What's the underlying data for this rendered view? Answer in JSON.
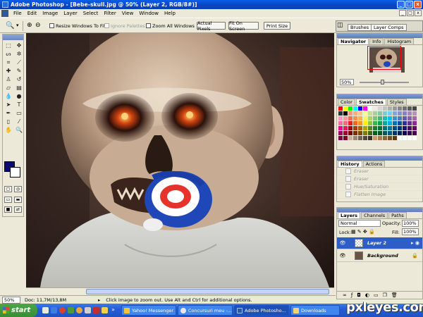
{
  "window": {
    "title": "Adobe Photoshop - [Bebe-skull.jpg @ 50% (Layer 2, RGB/8#)]",
    "minimize": "_",
    "maximize": "□",
    "close": "x"
  },
  "menu": {
    "items": [
      "File",
      "Edit",
      "Image",
      "Layer",
      "Select",
      "Filter",
      "View",
      "Window",
      "Help"
    ],
    "doc_minimize": "_",
    "doc_maximize": "□",
    "doc_close": "x"
  },
  "options_bar": {
    "resize_windows": "Resize Windows To Fit",
    "ignore_palettes": "Ignore Palettes",
    "zoom_all_windows": "Zoom All Windows",
    "actual_pixels": "Actual Pixels",
    "fit_on_screen": "Fit On Screen",
    "print_size": "Print Size",
    "brushes_tab": "Brushes",
    "layer_comps_tab": "Layer Comps"
  },
  "navigator": {
    "tabs": [
      "Navigator",
      "Info",
      "Histogram"
    ],
    "zoom": "50%"
  },
  "swatches": {
    "tabs": [
      "Color",
      "Swatches",
      "Styles"
    ],
    "colors": [
      "#ff0000",
      "#ffff00",
      "#00ff00",
      "#00ffff",
      "#0000ff",
      "#ff00ff",
      "#ffffff",
      "#ebebeb",
      "#d6d6d6",
      "#c2c2c2",
      "#adadad",
      "#999999",
      "#858585",
      "#707070",
      "#5c5c5c",
      "#474747",
      "#333333",
      "#000000",
      "#f7977a",
      "#f9ad81",
      "#fdc68a",
      "#fff79a",
      "#c4df9b",
      "#a2d39c",
      "#82ca9d",
      "#7bcdc8",
      "#6ecff6",
      "#7ea7d8",
      "#8493ca",
      "#8882be",
      "#a187be",
      "#bc8dbf",
      "#f49ac2",
      "#f6989d",
      "#f26c4f",
      "#f68e55",
      "#fbaf5c",
      "#fff467",
      "#acd372",
      "#7cc576",
      "#3bb878",
      "#1abbb4",
      "#00bff3",
      "#438ccb",
      "#5574b9",
      "#605ca8",
      "#855fa8",
      "#a763a8",
      "#f06eaa",
      "#f26d7d",
      "#ed1c24",
      "#f26522",
      "#f7941d",
      "#fff200",
      "#8dc73f",
      "#39b54a",
      "#00a651",
      "#00a99d",
      "#00aeef",
      "#0072bc",
      "#0054a6",
      "#2e3192",
      "#662d91",
      "#92278f",
      "#ec008c",
      "#ed145b",
      "#9e0b0f",
      "#a0410d",
      "#a36209",
      "#aba000",
      "#598527",
      "#1a7b30",
      "#007236",
      "#00746b",
      "#0076a3",
      "#004b80",
      "#003471",
      "#1b1464",
      "#440e62",
      "#630460",
      "#9e005d",
      "#9e0039",
      "#790000",
      "#7b2e00",
      "#7d4900",
      "#827b00",
      "#406618",
      "#005e20",
      "#005826",
      "#005952",
      "#005b7f",
      "#003663",
      "#002157",
      "#0d004c",
      "#32004b",
      "#4b0049",
      "#7b0046",
      "#7a0026",
      "#c7b299",
      "#998675",
      "#736357",
      "#534741",
      "#37302d",
      "#c69c6d",
      "#a67c52",
      "#8c6239",
      "#754c24",
      "#603913",
      "#ffffff",
      "#ffffff",
      "#ffffff",
      "#ffffff"
    ]
  },
  "history": {
    "tabs": [
      "History",
      "Actions"
    ],
    "items": [
      "Eraser",
      "Eraser",
      "Hue/Saturation",
      "Flatten Image"
    ]
  },
  "layers": {
    "tabs": [
      "Layers",
      "Channels",
      "Paths"
    ],
    "blend_mode": "Normal",
    "opacity_label": "Opacity:",
    "opacity_value": "100%",
    "lock_label": "Lock:",
    "fill_label": "Fill:",
    "fill_value": "100%",
    "items": [
      {
        "name": "Layer 2",
        "selected": true
      },
      {
        "name": "Background",
        "selected": false
      }
    ]
  },
  "status_bar": {
    "zoom": "50%",
    "doc": "Doc: 11,7M/13,8M",
    "message": "Click image to zoom out. Use Alt and Ctrl for additional options."
  },
  "taskbar": {
    "start": "start",
    "tasks": [
      {
        "label": "Yahoo! Messenger",
        "color": "#f5c342"
      },
      {
        "label": "Concursuri meu -...",
        "color": "#e8e8e8"
      },
      {
        "label": "Adobe Photosho...",
        "color": "#2c5aa0"
      },
      {
        "label": "Downloads",
        "color": "#f2d27a"
      }
    ]
  },
  "watermark": "pxleyes.com"
}
